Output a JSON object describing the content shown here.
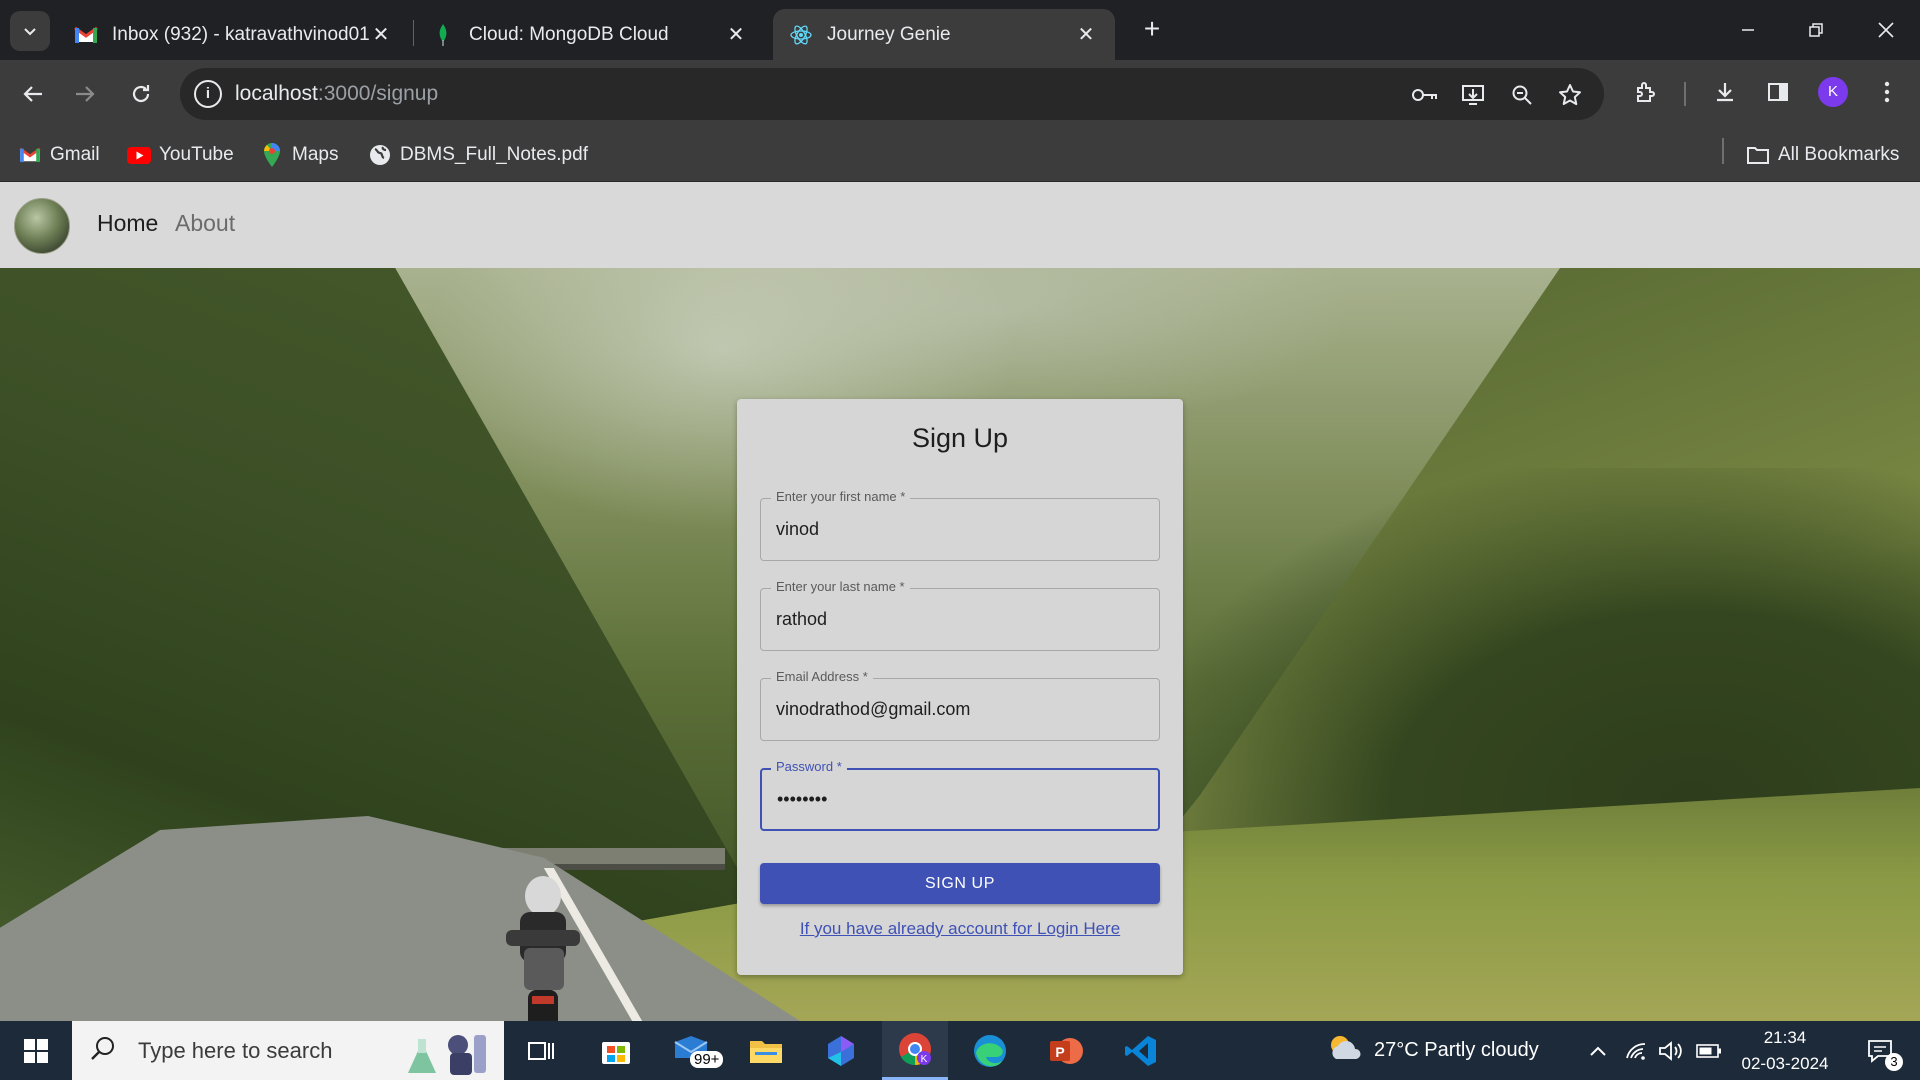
{
  "browser": {
    "tabs": [
      {
        "title": "Inbox (932) - katravathvinod01(",
        "icon": "gmail-icon",
        "active": false
      },
      {
        "title": "Cloud: MongoDB Cloud",
        "icon": "mongodb-leaf-icon",
        "active": false
      },
      {
        "title": "Journey Genie",
        "icon": "react-icon",
        "active": true
      }
    ],
    "url_host": "localhost",
    "url_path": ":3000/signup",
    "profile_initial": "K",
    "bookmarks": [
      {
        "label": "Gmail",
        "icon": "gmail-icon"
      },
      {
        "label": "YouTube",
        "icon": "youtube-icon"
      },
      {
        "label": "Maps",
        "icon": "maps-pin-icon"
      },
      {
        "label": "DBMS_Full_Notes.pdf",
        "icon": "globe-icon"
      }
    ],
    "all_bookmarks": "All Bookmarks"
  },
  "app": {
    "nav": {
      "home": "Home",
      "about": "About"
    },
    "signup": {
      "title": "Sign Up",
      "first_name": {
        "label": "Enter your first name *",
        "value": "vinod"
      },
      "last_name": {
        "label": "Enter your last name *",
        "value": "rathod"
      },
      "email": {
        "label": "Email Address *",
        "value": "vinodrathod@gmail.com"
      },
      "password": {
        "label": "Password *",
        "value": "••••••••"
      },
      "submit": "SIGN UP",
      "login_link": "If you have already account for Login Here"
    }
  },
  "taskbar": {
    "search_placeholder": "Type here to search",
    "mail_badge": "99+",
    "weather": "27°C  Partly cloudy",
    "time": "21:34",
    "date": "02-03-2024",
    "notification_count": "3"
  },
  "colors": {
    "accent": "#3f51b5",
    "chrome_dark": "#202124",
    "chrome_toolbar": "#3c3c3c",
    "card_bg": "#d6d6d6",
    "appbar_bg": "#d9d9d9",
    "taskbar_bg": "#1d2a3a"
  }
}
